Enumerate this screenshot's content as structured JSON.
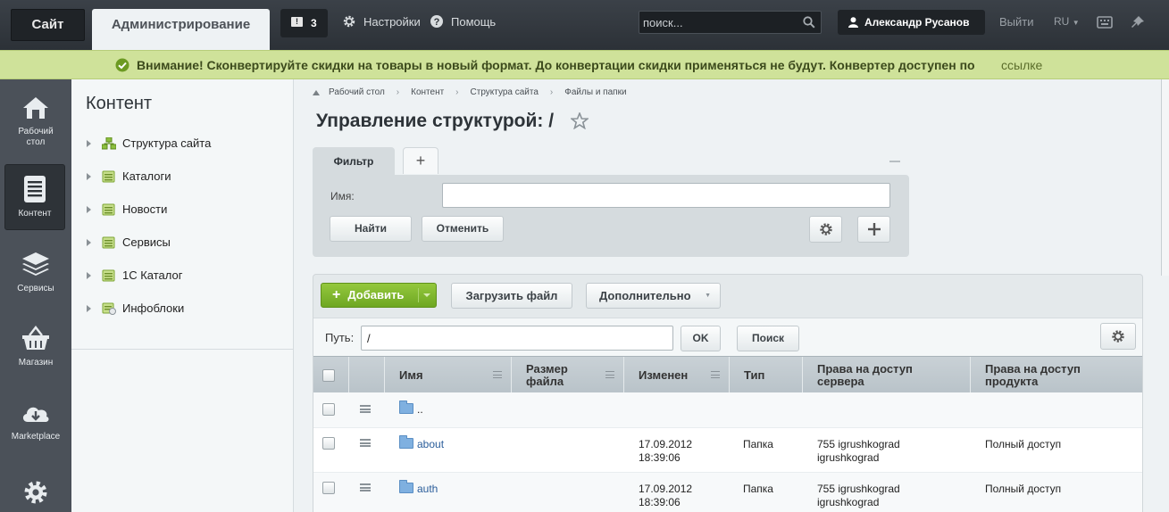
{
  "topbar": {
    "site_tab": "Сайт",
    "admin_tab": "Администрирование",
    "notifications_count": "3",
    "settings": "Настройки",
    "help": "Помощь",
    "search_placeholder": "поиск...",
    "user_name": "Александр Русанов",
    "logout": "Выйти",
    "lang": "RU"
  },
  "notice": {
    "text": "Внимание! Сконвертируйте скидки на товары в новый формат. До конвертации скидки применяться не будут. Конвертер доступен по",
    "link": "ссылке"
  },
  "rail": {
    "items": [
      {
        "label": "Рабочий стол",
        "icon": "home-icon"
      },
      {
        "label": "Контент",
        "icon": "document-icon"
      },
      {
        "label": "Сервисы",
        "icon": "layers-icon"
      },
      {
        "label": "Магазин",
        "icon": "basket-icon"
      },
      {
        "label": "Marketplace",
        "icon": "cloud-download-icon"
      },
      {
        "label": "",
        "icon": "gear-icon"
      }
    ]
  },
  "tree": {
    "title": "Контент",
    "items": [
      {
        "label": "Структура сайта",
        "icon": "site-structure-icon"
      },
      {
        "label": "Каталоги",
        "icon": "catalog-icon"
      },
      {
        "label": "Новости",
        "icon": "catalog-icon"
      },
      {
        "label": "Сервисы",
        "icon": "catalog-icon"
      },
      {
        "label": "1С Каталог",
        "icon": "catalog-icon"
      },
      {
        "label": "Инфоблоки",
        "icon": "iblock-icon"
      }
    ]
  },
  "breadcrumb": [
    "Рабочий стол",
    "Контент",
    "Структура сайта",
    "Файлы и папки"
  ],
  "page_title": "Управление структурой: /",
  "filter": {
    "tab": "Фильтр",
    "add_tab": "+",
    "name_label": "Имя:",
    "name_value": "",
    "find": "Найти",
    "cancel": "Отменить"
  },
  "toolbar": {
    "add": "Добавить",
    "upload": "Загрузить файл",
    "more": "Дополнительно"
  },
  "pathbar": {
    "label": "Путь:",
    "value": "/",
    "ok": "OK",
    "search": "Поиск"
  },
  "table": {
    "columns": [
      "Имя",
      "Размер файла",
      "Изменен",
      "Тип",
      "Права на доступ сервера",
      "Права на доступ продукта"
    ],
    "rows": [
      {
        "name": "..",
        "size": "",
        "modified": "",
        "type": "",
        "server_rights": "",
        "product_rights": "",
        "up": true
      },
      {
        "name": "about",
        "size": "",
        "modified": "17.09.2012 18:39:06",
        "type": "Папка",
        "server_rights": "755 igrushkograd igrushkograd",
        "product_rights": "Полный доступ"
      },
      {
        "name": "auth",
        "size": "",
        "modified": "17.09.2012 18:39:06",
        "type": "Папка",
        "server_rights": "755 igrushkograd igrushkograd",
        "product_rights": "Полный доступ"
      }
    ]
  },
  "colors": {
    "accent_green": "#7ab52d",
    "notice_bg": "#cfe29a",
    "topbar_bg": "#33383e"
  }
}
